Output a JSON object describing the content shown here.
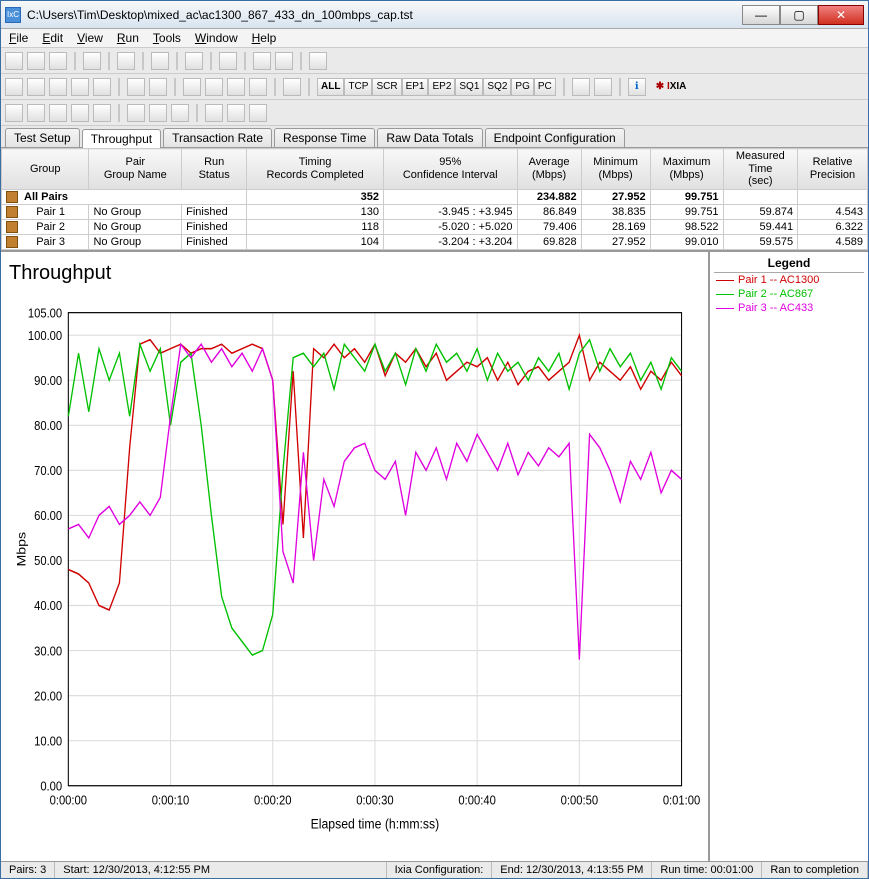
{
  "window": {
    "title": "C:\\Users\\Tim\\Desktop\\mixed_ac\\ac1300_867_433_dn_100mbps_cap.tst",
    "app_icon_text": "IxC"
  },
  "menu": [
    "File",
    "Edit",
    "View",
    "Run",
    "Tools",
    "Window",
    "Help"
  ],
  "toolbar3": {
    "filters": [
      "ALL",
      "TCP",
      "SCR",
      "EP1",
      "EP2",
      "SQ1",
      "SQ2",
      "PG",
      "PC"
    ],
    "brand_prefix": "I",
    "brand_suffix": "XIA"
  },
  "tabs": [
    "Test Setup",
    "Throughput",
    "Transaction Rate",
    "Response Time",
    "Raw Data Totals",
    "Endpoint Configuration"
  ],
  "active_tab": 1,
  "grid": {
    "headers": [
      "Group",
      "Pair Group Name",
      "Run Status",
      "Timing Records Completed",
      "95% Confidence Interval",
      "Average (Mbps)",
      "Minimum (Mbps)",
      "Maximum (Mbps)",
      "Measured Time (sec)",
      "Relative Precision"
    ],
    "summary": {
      "label": "All Pairs",
      "completed": 352,
      "avg": "234.882",
      "min": "27.952",
      "max": "99.751"
    },
    "rows": [
      {
        "pair": "Pair 1",
        "group": "No Group",
        "status": "Finished",
        "completed": 130,
        "ci": "-3.945 : +3.945",
        "avg": "86.849",
        "min": "38.835",
        "max": "99.751",
        "time": "59.874",
        "prec": "4.543"
      },
      {
        "pair": "Pair 2",
        "group": "No Group",
        "status": "Finished",
        "completed": 118,
        "ci": "-5.020 : +5.020",
        "avg": "79.406",
        "min": "28.169",
        "max": "98.522",
        "time": "59.441",
        "prec": "6.322"
      },
      {
        "pair": "Pair 3",
        "group": "No Group",
        "status": "Finished",
        "completed": 104,
        "ci": "-3.204 : +3.204",
        "avg": "69.828",
        "min": "27.952",
        "max": "99.010",
        "time": "59.575",
        "prec": "4.589"
      }
    ]
  },
  "legend": {
    "title": "Legend",
    "items": [
      {
        "label": "Pair 1 -- AC1300",
        "color": "#d00000"
      },
      {
        "label": "Pair 2 -- AC867",
        "color": "#00c000"
      },
      {
        "label": "Pair 3 -- AC433",
        "color": "#e000e0"
      }
    ]
  },
  "statusbar": {
    "pairs": "Pairs: 3",
    "start": "Start: 12/30/2013, 4:12:55 PM",
    "config": "Ixia Configuration:",
    "end": "End: 12/30/2013, 4:13:55 PM",
    "runtime": "Run time: 00:01:00",
    "result": "Ran to completion"
  },
  "chart_data": {
    "type": "line",
    "title": "Throughput",
    "xlabel": "Elapsed time (h:mm:ss)",
    "ylabel": "Mbps",
    "ylim": [
      0,
      105
    ],
    "x_tick_labels": [
      "0:00:00",
      "0:00:10",
      "0:00:20",
      "0:00:30",
      "0:00:40",
      "0:00:50",
      "0:01:00"
    ],
    "x": [
      0,
      1,
      2,
      3,
      4,
      5,
      6,
      7,
      8,
      9,
      10,
      11,
      12,
      13,
      14,
      15,
      16,
      17,
      18,
      19,
      20,
      21,
      22,
      23,
      24,
      25,
      26,
      27,
      28,
      29,
      30,
      31,
      32,
      33,
      34,
      35,
      36,
      37,
      38,
      39,
      40,
      41,
      42,
      43,
      44,
      45,
      46,
      47,
      48,
      49,
      50,
      51,
      52,
      53,
      54,
      55,
      56,
      57,
      58,
      59,
      60
    ],
    "series": [
      {
        "name": "Pair 1 -- AC1300",
        "color": "#d00000",
        "values": [
          48,
          47,
          45,
          40,
          39,
          45,
          75,
          98,
          99,
          96,
          97,
          98,
          96,
          97,
          97,
          98,
          96,
          97,
          98,
          97,
          90,
          58,
          92,
          55,
          97,
          95,
          98,
          95,
          97,
          94,
          98,
          91,
          96,
          94,
          97,
          93,
          96,
          90,
          92,
          94,
          93,
          95,
          90,
          94,
          89,
          92,
          93,
          90,
          92,
          94,
          100,
          90,
          94,
          92,
          90,
          93,
          88,
          92,
          90,
          94,
          91
        ]
      },
      {
        "name": "Pair 2 -- AC867",
        "color": "#00c000",
        "values": [
          82,
          96,
          83,
          97,
          90,
          96,
          82,
          98,
          92,
          97,
          80,
          94,
          96,
          80,
          60,
          42,
          35,
          32,
          29,
          30,
          38,
          70,
          95,
          96,
          93,
          96,
          88,
          98,
          95,
          92,
          98,
          92,
          96,
          89,
          97,
          92,
          98,
          94,
          96,
          92,
          97,
          90,
          96,
          92,
          94,
          90,
          95,
          92,
          96,
          88,
          96,
          99,
          92,
          97,
          93,
          96,
          90,
          94,
          88,
          95,
          92
        ]
      },
      {
        "name": "Pair 3 -- AC433",
        "color": "#e000e0",
        "values": [
          57,
          58,
          55,
          60,
          62,
          58,
          60,
          63,
          60,
          64,
          82,
          98,
          95,
          98,
          94,
          97,
          93,
          96,
          92,
          97,
          90,
          52,
          45,
          74,
          50,
          68,
          62,
          72,
          75,
          76,
          70,
          68,
          72,
          60,
          74,
          70,
          75,
          68,
          76,
          72,
          78,
          74,
          70,
          76,
          69,
          74,
          71,
          75,
          73,
          76,
          28,
          78,
          75,
          70,
          63,
          72,
          68,
          74,
          65,
          70,
          68
        ]
      }
    ]
  }
}
